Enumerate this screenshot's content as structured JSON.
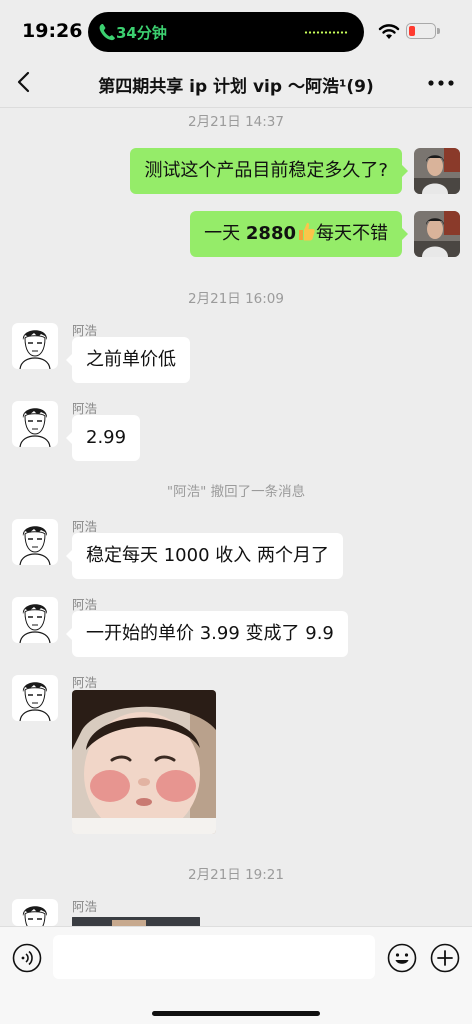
{
  "status_bar": {
    "time": "19:26",
    "call_duration": "34分钟"
  },
  "header": {
    "title": "第四期共享 ip 计划 vip ～阿浩¹(9)"
  },
  "messages": {
    "ts1": "2月21日 14:37",
    "out1": "测试这个产品目前稳定多久了?",
    "out2_pre": "一天 ",
    "out2_num": "2880",
    "out2_post": "每天不错",
    "ts2": "2月21日 16:09",
    "sender": "阿浩",
    "in1": "之前单价低",
    "in2": "2.99",
    "recall": "\"阿浩\" 撤回了一条消息",
    "in3": "稳定每天 1000 收入 两个月了",
    "in4": "一开始的单价 3.99 变成了 9.9",
    "ts3": "2月21日 19:21"
  },
  "input": {
    "placeholder": ""
  },
  "colors": {
    "accent_green": "#95ec69",
    "call_green": "#3cd070",
    "battery_low": "#ff3b30"
  }
}
